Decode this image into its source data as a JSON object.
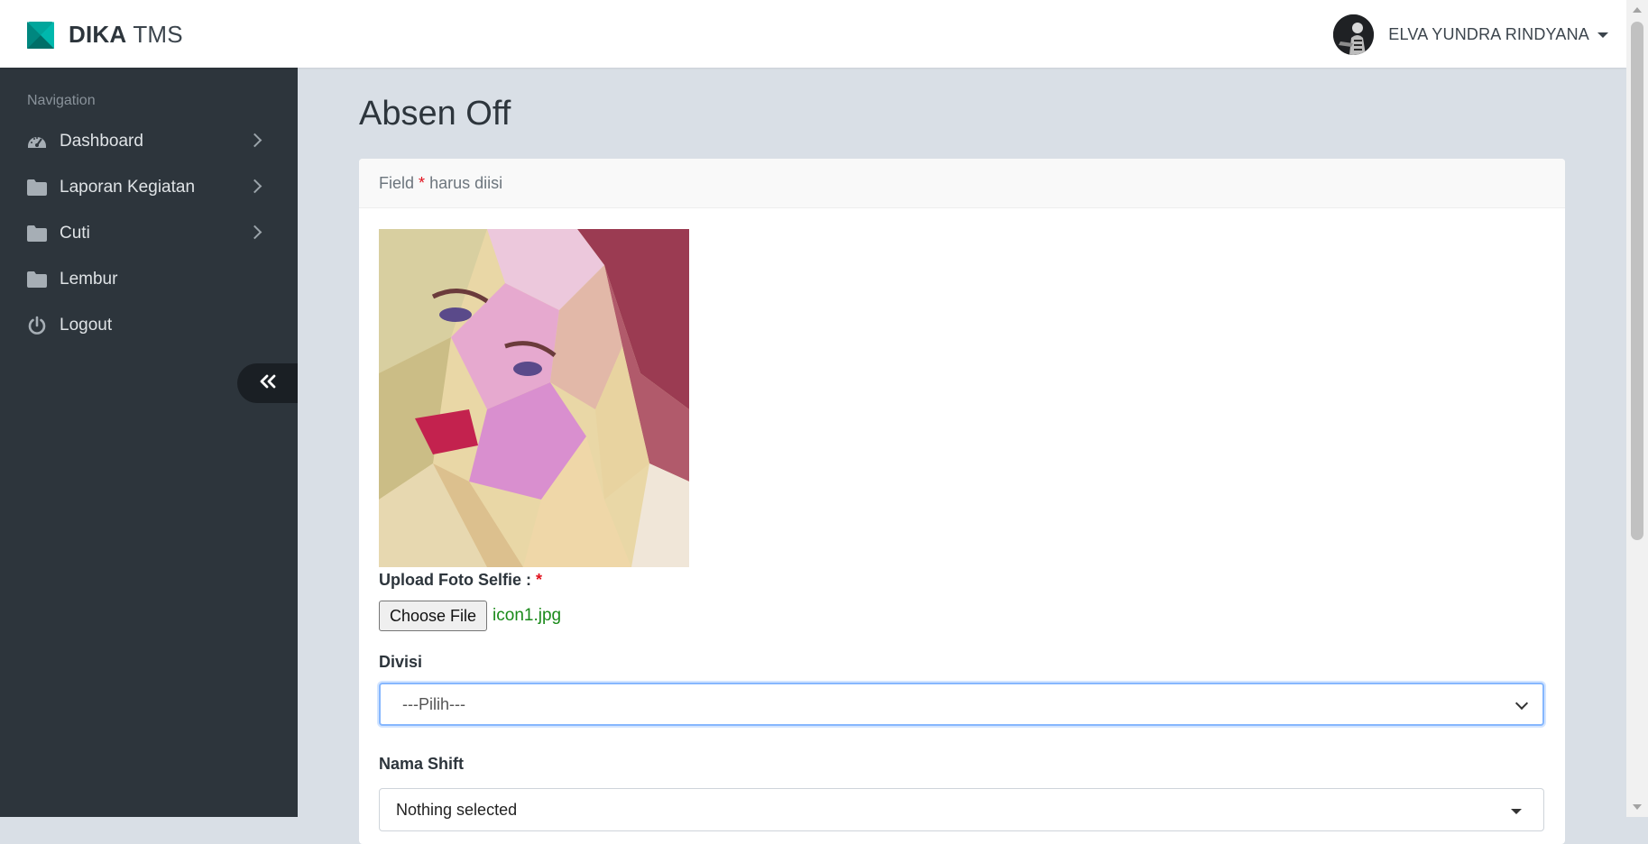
{
  "brand": {
    "name_bold": "DIKA",
    "name_light": "TMS",
    "accent": "#00a69c"
  },
  "user": {
    "name": "ELVA YUNDRA RINDYANA"
  },
  "sidebar": {
    "header": "Navigation",
    "items": [
      {
        "label": "Dashboard",
        "icon": "gauge-icon",
        "has_submenu": true
      },
      {
        "label": "Laporan Kegiatan",
        "icon": "folder-icon",
        "has_submenu": true
      },
      {
        "label": "Cuti",
        "icon": "folder-icon",
        "has_submenu": true
      },
      {
        "label": "Lembur",
        "icon": "folder-icon",
        "has_submenu": false
      },
      {
        "label": "Logout",
        "icon": "power-icon",
        "has_submenu": false
      }
    ],
    "minify_icon": "double-chevron-left-icon"
  },
  "page": {
    "title": "Absen Off",
    "notice": {
      "prefix": "Field",
      "asterisk": "*",
      "suffix": "harus diisi"
    }
  },
  "form": {
    "upload": {
      "label": "Upload Foto Selfie :",
      "required_mark": "*",
      "button": "Choose File",
      "file_name": "icon1.jpg"
    },
    "divisi": {
      "label": "Divisi",
      "value": "---Pilih---"
    },
    "shift": {
      "label": "Nama Shift",
      "value": "Nothing selected"
    }
  },
  "colors": {
    "sidebar_bg": "#2d353c",
    "content_bg": "#d9dfe6",
    "required": "#e1111d",
    "file_name": "#1a8a1a",
    "focus": "#86b7fe"
  }
}
